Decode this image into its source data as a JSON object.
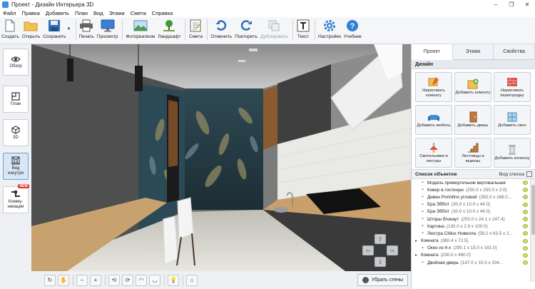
{
  "window": {
    "title": "Проект - Дизайн Интерьера 3D",
    "buttons": [
      "–",
      "❐",
      "✕"
    ]
  },
  "menu": [
    "Файл",
    "Правка",
    "Добавить",
    "План",
    "Вид",
    "Этажи",
    "Смета",
    "Справка"
  ],
  "toolbar": {
    "create": "Создать",
    "open": "Открыть",
    "save": "Сохранить",
    "print": "Печать",
    "preview": "Просмотр",
    "photorealism": "Фотореализм",
    "landscape": "Ландшафт",
    "estimate": "Смета",
    "undo": "Отменить",
    "redo": "Повторить",
    "duplicate": "Дублировать",
    "text": "Текст",
    "settings": "Настройки",
    "tutorial": "Учебник"
  },
  "leftbar": {
    "overview": "Обзор",
    "plan": "План",
    "view3d": "3D",
    "inside": "Вид изнутри",
    "comms": "Комму-никации",
    "new_badge": "NEW"
  },
  "bottombar": {
    "remove_walls": "Убрать стены"
  },
  "rightpanel": {
    "tabs": [
      "Проект",
      "Этажи",
      "Свойства"
    ],
    "design_header": "Дизайн",
    "design_buttons": [
      {
        "label": "Нарисовать комнату",
        "icon": "draw-room-icon"
      },
      {
        "label": "Добавить комнату",
        "icon": "add-room-icon"
      },
      {
        "label": "Нарисовать перегородку",
        "icon": "draw-partition-icon"
      },
      {
        "label": "Добавить мебель",
        "icon": "add-furniture-icon"
      },
      {
        "label": "Добавить дверь",
        "icon": "add-door-icon"
      },
      {
        "label": "Добавить окно",
        "icon": "add-window-icon"
      },
      {
        "label": "Светильники и люстры",
        "icon": "lamp-icon"
      },
      {
        "label": "Лестницы и вырезы",
        "icon": "stairs-icon"
      },
      {
        "label": "Добавить колонну",
        "icon": "column-icon"
      }
    ],
    "objlist_title": "Список объектов",
    "objlist_view": "Вид списка",
    "objects": [
      {
        "name": "Модель прямоугольник вертикальная",
        "size": "",
        "level": 1
      },
      {
        "name": "Ковер в гостиную",
        "size": "(250.0 x 250.0 x 2.0)",
        "level": 1
      },
      {
        "name": "Диван Portofino угловой",
        "size": "(282.0 x 168.0...",
        "level": 1
      },
      {
        "name": "Бра Эббот",
        "size": "(30.0 x 10.0 x 44.0)",
        "level": 1
      },
      {
        "name": "Бра Эббот",
        "size": "(30.0 x 10.0 x 44.0)",
        "level": 1
      },
      {
        "name": "Шторы блэкаут",
        "size": "(250.0 x 24.1 x 247.4)",
        "level": 1
      },
      {
        "name": "Картина",
        "size": "(130.0 x 2.9 x 100.0)",
        "level": 1
      },
      {
        "name": "Люстра Citilux Новелла",
        "size": "(58.2 x 63.5 x 2...",
        "level": 1
      },
      {
        "name": "Комната",
        "size": "(380.4 x 72.5)",
        "level": 0
      },
      {
        "name": "Окно из 4-х",
        "size": "(290.1 x 15.0 x 161.0)",
        "level": 1
      },
      {
        "name": "Комната",
        "size": "(230.0 x 480.0)",
        "level": 0
      },
      {
        "name": "Двойная дверь",
        "size": "(147.0 x 15.0 x 204...",
        "level": 1
      }
    ]
  }
}
